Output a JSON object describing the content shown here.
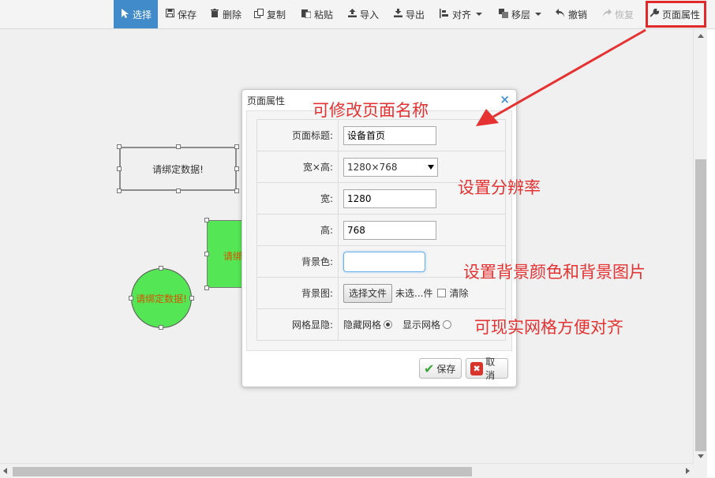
{
  "toolbar": {
    "items": [
      {
        "label": "选择",
        "icon": "cursor-icon"
      },
      {
        "label": "保存",
        "icon": "save-icon"
      },
      {
        "label": "删除",
        "icon": "trash-icon"
      },
      {
        "label": "复制",
        "icon": "copy-icon"
      },
      {
        "label": "粘贴",
        "icon": "paste-icon"
      },
      {
        "label": "导入",
        "icon": "import-icon"
      },
      {
        "label": "导出",
        "icon": "export-icon"
      },
      {
        "label": "对齐",
        "icon": "align-icon"
      },
      {
        "label": "移层",
        "icon": "layer-icon"
      },
      {
        "label": "撤销",
        "icon": "undo-icon"
      },
      {
        "label": "恢复",
        "icon": "redo-icon"
      },
      {
        "label": "页面属性",
        "icon": "wrench-icon"
      }
    ]
  },
  "canvas": {
    "rect_text": "请绑定数据!",
    "green_rect_text": "请绑",
    "circle_text": "请绑定数据!"
  },
  "dialog": {
    "title": "页面属性",
    "close": "×",
    "fields": {
      "title_label": "页面标题:",
      "title_value": "设备首页",
      "resolution_label": "宽×高:",
      "resolution_value": "1280×768",
      "width_label": "宽:",
      "width_value": "1280",
      "height_label": "高:",
      "height_value": "768",
      "bgcolor_label": "背景色:",
      "bgimage_label": "背景图:",
      "file_button": "选择文件",
      "file_status": "未选...件",
      "clear_label": "清除",
      "grid_label": "网格显隐:",
      "grid_hide": "隐藏网格",
      "grid_show": "显示网格"
    },
    "ok_label": "保存",
    "cancel_label": "取消"
  },
  "annotations": {
    "rename": "可修改页面名称",
    "resolution": "设置分辨率",
    "background": "设置背景颜色和背景图片",
    "grid": "可现实网格方便对齐"
  },
  "colors": {
    "accent": "#428bca",
    "annotation_red": "#e63232",
    "shape_green": "#55e655"
  }
}
